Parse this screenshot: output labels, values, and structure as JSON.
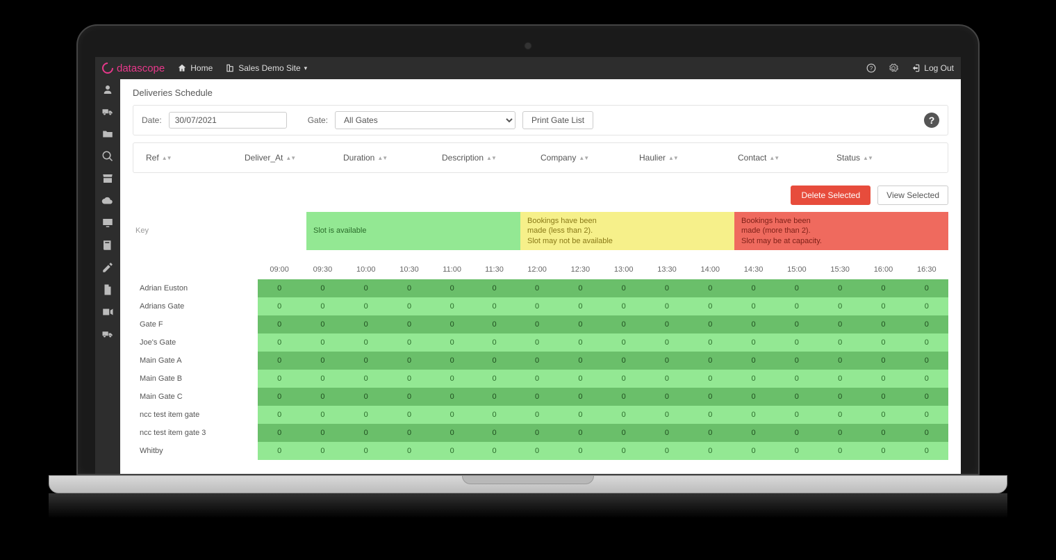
{
  "brand": "datascope",
  "topbar": {
    "home": "Home",
    "site_label": "Sales Demo Site",
    "logout": "Log Out"
  },
  "page_title": "Deliveries Schedule",
  "filters": {
    "date_label": "Date:",
    "date_value": "30/07/2021",
    "gate_label": "Gate:",
    "gate_value": "All Gates",
    "print_btn": "Print Gate List"
  },
  "columns": [
    "Ref",
    "Deliver_At",
    "Duration",
    "Description",
    "Company",
    "Haulier",
    "Contact",
    "Status"
  ],
  "actions": {
    "delete": "Delete Selected",
    "view": "View Selected"
  },
  "key": {
    "label": "Key",
    "green": "Slot is available",
    "yellow_l1": "Bookings have been",
    "yellow_l2": "made (less than 2).",
    "yellow_l3": "Slot may not be available",
    "red_l1": "Bookings have been",
    "red_l2": "made (more than 2).",
    "red_l3": "Slot may be at capacity."
  },
  "times": [
    "09:00",
    "09:30",
    "10:00",
    "10:30",
    "11:00",
    "11:30",
    "12:00",
    "12:30",
    "13:00",
    "13:30",
    "14:00",
    "14:30",
    "15:00",
    "15:30",
    "16:00",
    "16:30"
  ],
  "gates": [
    "Adrian Euston",
    "Adrians Gate",
    "Gate F",
    "Joe's Gate",
    "Main Gate A",
    "Main Gate B",
    "Main Gate C",
    "ncc test item gate",
    "ncc test item gate 3",
    "Whitby"
  ],
  "cell_value": "0"
}
